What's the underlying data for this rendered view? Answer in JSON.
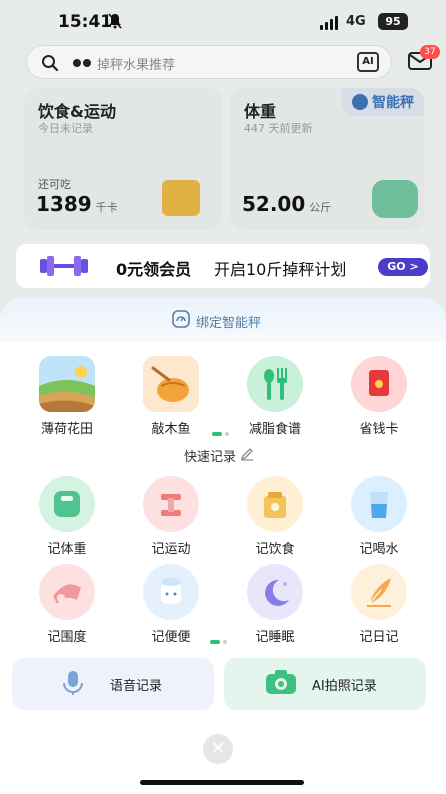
{
  "status_bar": {
    "time": "15:41",
    "network": "4G",
    "battery": "95"
  },
  "search": {
    "placeholder": "掉秤水果推荐",
    "scan_label": "AI",
    "mail_badge": "37"
  },
  "cards": {
    "diet": {
      "title": "饮食&运动",
      "subtitle": "今日未记录",
      "remaining_label": "还可吃",
      "value": "1389",
      "unit": "千卡"
    },
    "weight": {
      "title": "体重",
      "subtitle": "447 天前更新",
      "value": "52.00",
      "unit": "公斤",
      "badge": "智能秤"
    }
  },
  "banner": {
    "main": "0元领会员",
    "sub": "开启10斤掉秤计划",
    "cta": "GO >"
  },
  "sheet": {
    "bind_label": "绑定智能秤",
    "features": [
      {
        "label": "薄荷花田",
        "icon": "farm-icon"
      },
      {
        "label": "敲木鱼",
        "icon": "wooden-fish-icon"
      },
      {
        "label": "减脂食谱",
        "icon": "fork-spoon-icon"
      },
      {
        "label": "省钱卡",
        "icon": "red-envelope-icon"
      }
    ],
    "quick_title": "快速记录",
    "quick_row1": [
      {
        "label": "记体重",
        "icon": "scale-icon"
      },
      {
        "label": "记运动",
        "icon": "dumbbell-icon"
      },
      {
        "label": "记饮食",
        "icon": "food-bag-icon"
      },
      {
        "label": "记喝水",
        "icon": "water-cup-icon"
      }
    ],
    "quick_row2": [
      {
        "label": "记围度",
        "icon": "tape-measure-icon"
      },
      {
        "label": "记便便",
        "icon": "toilet-paper-icon"
      },
      {
        "label": "记睡眠",
        "icon": "moon-icon"
      },
      {
        "label": "记日记",
        "icon": "feather-pen-icon"
      }
    ],
    "voice_label": "语音记录",
    "photo_label": "AI拍照记录"
  },
  "colors": {
    "accent": "#4a3ec9",
    "green": "#2fbf7a",
    "blue": "#557ea6"
  }
}
